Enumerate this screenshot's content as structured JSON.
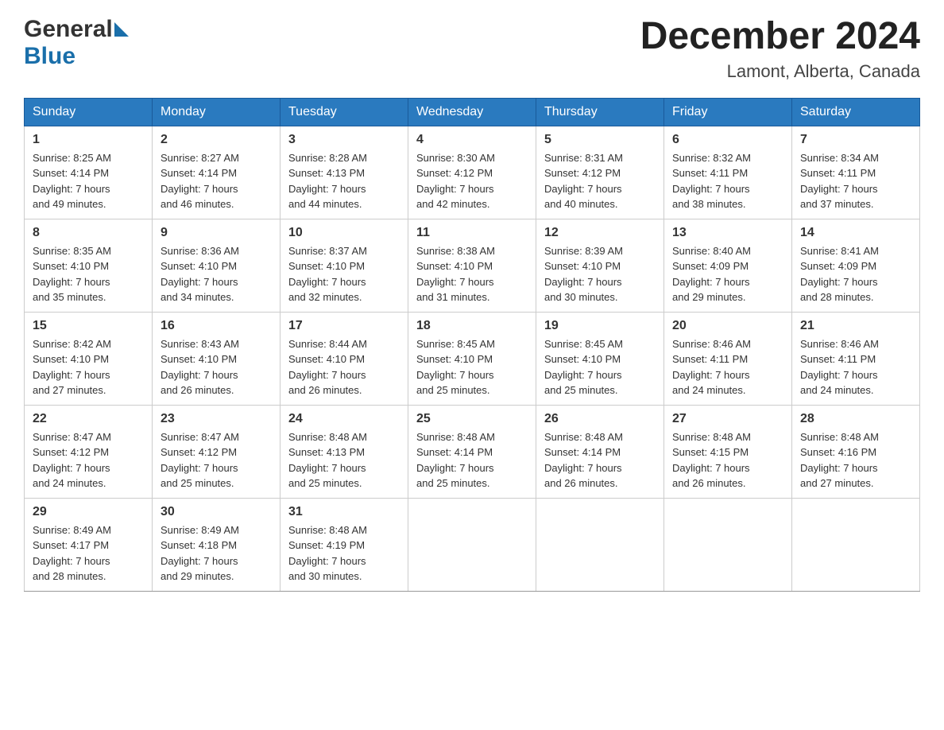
{
  "header": {
    "logo_general": "General",
    "logo_blue": "Blue",
    "title": "December 2024",
    "subtitle": "Lamont, Alberta, Canada"
  },
  "days_of_week": [
    "Sunday",
    "Monday",
    "Tuesday",
    "Wednesday",
    "Thursday",
    "Friday",
    "Saturday"
  ],
  "weeks": [
    [
      {
        "day": "1",
        "sunrise": "8:25 AM",
        "sunset": "4:14 PM",
        "daylight": "7 hours and 49 minutes."
      },
      {
        "day": "2",
        "sunrise": "8:27 AM",
        "sunset": "4:14 PM",
        "daylight": "7 hours and 46 minutes."
      },
      {
        "day": "3",
        "sunrise": "8:28 AM",
        "sunset": "4:13 PM",
        "daylight": "7 hours and 44 minutes."
      },
      {
        "day": "4",
        "sunrise": "8:30 AM",
        "sunset": "4:12 PM",
        "daylight": "7 hours and 42 minutes."
      },
      {
        "day": "5",
        "sunrise": "8:31 AM",
        "sunset": "4:12 PM",
        "daylight": "7 hours and 40 minutes."
      },
      {
        "day": "6",
        "sunrise": "8:32 AM",
        "sunset": "4:11 PM",
        "daylight": "7 hours and 38 minutes."
      },
      {
        "day": "7",
        "sunrise": "8:34 AM",
        "sunset": "4:11 PM",
        "daylight": "7 hours and 37 minutes."
      }
    ],
    [
      {
        "day": "8",
        "sunrise": "8:35 AM",
        "sunset": "4:10 PM",
        "daylight": "7 hours and 35 minutes."
      },
      {
        "day": "9",
        "sunrise": "8:36 AM",
        "sunset": "4:10 PM",
        "daylight": "7 hours and 34 minutes."
      },
      {
        "day": "10",
        "sunrise": "8:37 AM",
        "sunset": "4:10 PM",
        "daylight": "7 hours and 32 minutes."
      },
      {
        "day": "11",
        "sunrise": "8:38 AM",
        "sunset": "4:10 PM",
        "daylight": "7 hours and 31 minutes."
      },
      {
        "day": "12",
        "sunrise": "8:39 AM",
        "sunset": "4:10 PM",
        "daylight": "7 hours and 30 minutes."
      },
      {
        "day": "13",
        "sunrise": "8:40 AM",
        "sunset": "4:09 PM",
        "daylight": "7 hours and 29 minutes."
      },
      {
        "day": "14",
        "sunrise": "8:41 AM",
        "sunset": "4:09 PM",
        "daylight": "7 hours and 28 minutes."
      }
    ],
    [
      {
        "day": "15",
        "sunrise": "8:42 AM",
        "sunset": "4:10 PM",
        "daylight": "7 hours and 27 minutes."
      },
      {
        "day": "16",
        "sunrise": "8:43 AM",
        "sunset": "4:10 PM",
        "daylight": "7 hours and 26 minutes."
      },
      {
        "day": "17",
        "sunrise": "8:44 AM",
        "sunset": "4:10 PM",
        "daylight": "7 hours and 26 minutes."
      },
      {
        "day": "18",
        "sunrise": "8:45 AM",
        "sunset": "4:10 PM",
        "daylight": "7 hours and 25 minutes."
      },
      {
        "day": "19",
        "sunrise": "8:45 AM",
        "sunset": "4:10 PM",
        "daylight": "7 hours and 25 minutes."
      },
      {
        "day": "20",
        "sunrise": "8:46 AM",
        "sunset": "4:11 PM",
        "daylight": "7 hours and 24 minutes."
      },
      {
        "day": "21",
        "sunrise": "8:46 AM",
        "sunset": "4:11 PM",
        "daylight": "7 hours and 24 minutes."
      }
    ],
    [
      {
        "day": "22",
        "sunrise": "8:47 AM",
        "sunset": "4:12 PM",
        "daylight": "7 hours and 24 minutes."
      },
      {
        "day": "23",
        "sunrise": "8:47 AM",
        "sunset": "4:12 PM",
        "daylight": "7 hours and 25 minutes."
      },
      {
        "day": "24",
        "sunrise": "8:48 AM",
        "sunset": "4:13 PM",
        "daylight": "7 hours and 25 minutes."
      },
      {
        "day": "25",
        "sunrise": "8:48 AM",
        "sunset": "4:14 PM",
        "daylight": "7 hours and 25 minutes."
      },
      {
        "day": "26",
        "sunrise": "8:48 AM",
        "sunset": "4:14 PM",
        "daylight": "7 hours and 26 minutes."
      },
      {
        "day": "27",
        "sunrise": "8:48 AM",
        "sunset": "4:15 PM",
        "daylight": "7 hours and 26 minutes."
      },
      {
        "day": "28",
        "sunrise": "8:48 AM",
        "sunset": "4:16 PM",
        "daylight": "7 hours and 27 minutes."
      }
    ],
    [
      {
        "day": "29",
        "sunrise": "8:49 AM",
        "sunset": "4:17 PM",
        "daylight": "7 hours and 28 minutes."
      },
      {
        "day": "30",
        "sunrise": "8:49 AM",
        "sunset": "4:18 PM",
        "daylight": "7 hours and 29 minutes."
      },
      {
        "day": "31",
        "sunrise": "8:48 AM",
        "sunset": "4:19 PM",
        "daylight": "7 hours and 30 minutes."
      },
      null,
      null,
      null,
      null
    ]
  ],
  "labels": {
    "sunrise": "Sunrise:",
    "sunset": "Sunset:",
    "daylight": "Daylight:"
  }
}
